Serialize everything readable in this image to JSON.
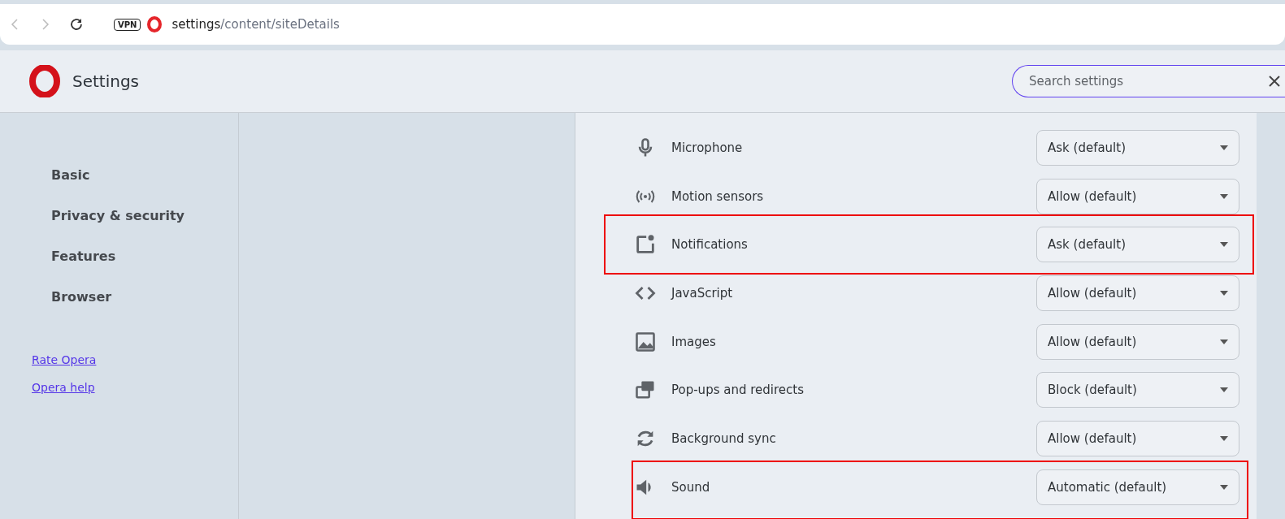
{
  "address_bar": {
    "vpn_badge": "VPN",
    "url_host": "settings",
    "url_path": "/content/siteDetails"
  },
  "header": {
    "title": "Settings",
    "search": {
      "placeholder": "Search settings"
    }
  },
  "sidebar": {
    "items": [
      {
        "label": "Basic"
      },
      {
        "label": "Privacy & security"
      },
      {
        "label": "Features"
      },
      {
        "label": "Browser"
      }
    ],
    "links": [
      "Rate Opera",
      "Opera help"
    ]
  },
  "permissions": [
    {
      "label": "Microphone",
      "value": "Ask (default)",
      "highlighted": false
    },
    {
      "label": "Motion sensors",
      "value": "Allow (default)",
      "highlighted": false
    },
    {
      "label": "Notifications",
      "value": "Ask (default)",
      "highlighted": true
    },
    {
      "label": "JavaScript",
      "value": "Allow (default)",
      "highlighted": false
    },
    {
      "label": "Images",
      "value": "Allow (default)",
      "highlighted": false
    },
    {
      "label": "Pop-ups and redirects",
      "value": "Block (default)",
      "highlighted": false
    },
    {
      "label": "Background sync",
      "value": "Allow (default)",
      "highlighted": false
    },
    {
      "label": "Sound",
      "value": "Automatic (default)",
      "highlighted": true
    }
  ]
}
